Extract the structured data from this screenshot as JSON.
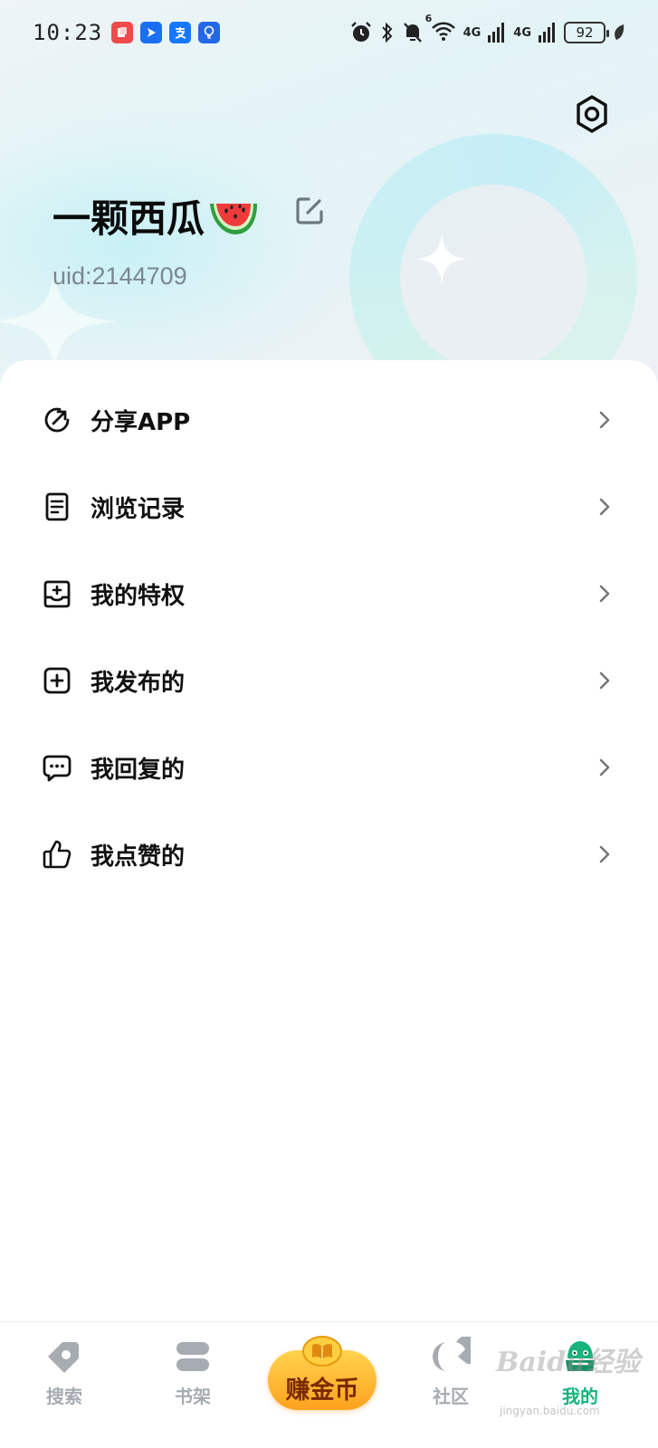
{
  "status_bar": {
    "time": "10:23",
    "signal_label_1": "4G",
    "signal_label_2": "4G",
    "wifi_badge": "6",
    "battery": "92"
  },
  "profile": {
    "name": "一颗西瓜",
    "uid": "uid:2144709"
  },
  "menu": {
    "items": [
      {
        "label": "分享APP",
        "icon": "share-icon"
      },
      {
        "label": "浏览记录",
        "icon": "history-icon"
      },
      {
        "label": "我的特权",
        "icon": "privilege-icon"
      },
      {
        "label": "我发布的",
        "icon": "add-square-icon"
      },
      {
        "label": "我回复的",
        "icon": "comment-icon"
      },
      {
        "label": "我点赞的",
        "icon": "thumbs-up-icon"
      }
    ]
  },
  "tabbar": {
    "tabs": [
      {
        "label": "搜索",
        "icon": "tag-search-icon"
      },
      {
        "label": "书架",
        "icon": "bookshelf-icon"
      },
      {
        "label": "赚金币",
        "icon": "gold-book-icon"
      },
      {
        "label": "社区",
        "icon": "community-icon"
      },
      {
        "label": "我的",
        "icon": "mascot-icon"
      }
    ],
    "active_index": 4
  },
  "watermark": {
    "text": "Baidu经验",
    "sub": "jingyan.baidu.com"
  },
  "colors": {
    "accent_green": "#17b37b",
    "inactive_tab": "#a7acb2",
    "earn_gold": "#ffb52e"
  }
}
